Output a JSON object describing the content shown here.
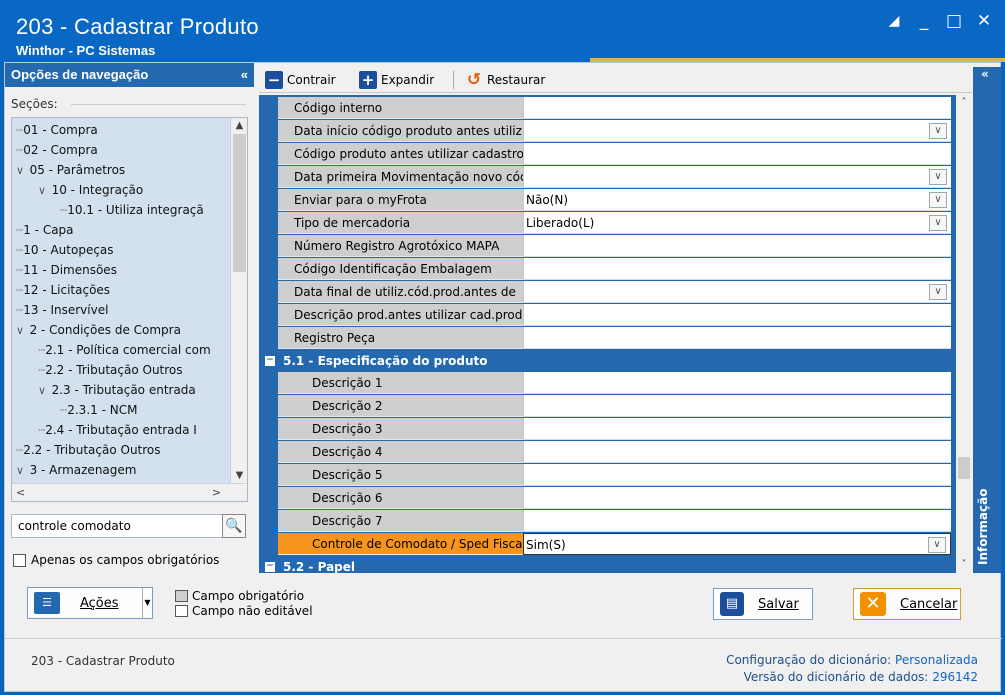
{
  "window": {
    "title": "203 - Cadastrar  Produto",
    "subtitle": "Winthor - PC Sistemas",
    "controls": [
      "■",
      "_",
      "□",
      "✕"
    ]
  },
  "nav": {
    "header": "Opções de navegação",
    "collapse": "«",
    "sections_label": "Seções:",
    "tree": [
      {
        "label": "01 - Compra",
        "level": 0,
        "exp": ""
      },
      {
        "label": "02 - Compra",
        "level": 0,
        "exp": ""
      },
      {
        "label": "05 - Parâmetros",
        "level": 0,
        "exp": "v"
      },
      {
        "label": "10 - Integração",
        "level": 1,
        "exp": "v"
      },
      {
        "label": "10.1 - Utiliza integraçã",
        "level": 2,
        "exp": ""
      },
      {
        "label": "1 - Capa",
        "level": 0,
        "exp": ""
      },
      {
        "label": "10 - Autopeças",
        "level": 0,
        "exp": ""
      },
      {
        "label": "11 - Dimensões",
        "level": 0,
        "exp": ""
      },
      {
        "label": "12 - Licitações",
        "level": 0,
        "exp": ""
      },
      {
        "label": "13 - Inservível",
        "level": 0,
        "exp": ""
      },
      {
        "label": "2 - Condições de Compra",
        "level": 0,
        "exp": "v"
      },
      {
        "label": "2.1 - Política comercial com",
        "level": 1,
        "exp": ""
      },
      {
        "label": "2.2 - Tributação Outros",
        "level": 1,
        "exp": ""
      },
      {
        "label": "2.3 - Tributação entrada",
        "level": 1,
        "exp": "v"
      },
      {
        "label": "2.3.1 - NCM",
        "level": 2,
        "exp": ""
      },
      {
        "label": "2.4 - Tributação entrada I",
        "level": 1,
        "exp": ""
      },
      {
        "label": "2.2 - Tributação Outros",
        "level": 0,
        "exp": ""
      },
      {
        "label": "3 - Armazenagem",
        "level": 0,
        "exp": "v"
      }
    ],
    "search_value": "controle comodato",
    "only_required_label": "Apenas os campos obrigatórios"
  },
  "toolbar": {
    "collapse_label": "Contrair",
    "expand_label": "Expandir",
    "restore_label": "Restaurar"
  },
  "grid": {
    "rows": [
      {
        "label": "Código interno",
        "value": "",
        "dropdown": false
      },
      {
        "label": "Data início código produto antes utiliz",
        "value": "",
        "dropdown": true
      },
      {
        "label": "Código produto antes utilizar cadastro",
        "value": "",
        "dropdown": false
      },
      {
        "label": "Data primeira Movimentação novo cód",
        "value": "",
        "dropdown": true
      },
      {
        "label": "Enviar para o myFrota",
        "value": "Não(N)",
        "dropdown": true
      },
      {
        "label": "Tipo de mercadoria",
        "value": "Liberado(L)",
        "dropdown": true
      },
      {
        "label": "Número Registro Agrotóxico MAPA",
        "value": "",
        "dropdown": false
      },
      {
        "label": "Código Identificação Embalagem",
        "value": "",
        "dropdown": false
      },
      {
        "label": "Data final de utiliz.cód.prod.antes de",
        "value": "",
        "dropdown": true
      },
      {
        "label": "Descrição prod.antes utilizar cad.prod",
        "value": "",
        "dropdown": false
      },
      {
        "label": "Registro Peça",
        "value": "",
        "dropdown": false
      }
    ],
    "group1": "5.1 - Especificação do produto",
    "group1_rows": [
      {
        "label": "Descrição 1",
        "value": ""
      },
      {
        "label": "Descrição 2",
        "value": ""
      },
      {
        "label": "Descrição 3",
        "value": ""
      },
      {
        "label": "Descrição 4",
        "value": ""
      },
      {
        "label": "Descrição 5",
        "value": ""
      },
      {
        "label": "Descrição 6",
        "value": ""
      },
      {
        "label": "Descrição 7",
        "value": ""
      }
    ],
    "highlight_row": {
      "label": "Controle de Comodato / Sped Fiscal",
      "value": "Sim(S)"
    },
    "group2": "5.2 - Papel"
  },
  "info_tab": {
    "label": "Informação",
    "collapse": "«"
  },
  "bottom": {
    "actions_label": "Ações",
    "legend_required": "Campo obrigatório",
    "legend_readonly": "Campo não editável",
    "save_label": "Salvar",
    "cancel_label": "Cancelar"
  },
  "status": {
    "left": "203 - Cadastrar  Produto",
    "dict_config_label": "Configuração do dicionário:",
    "dict_config_value": "Personalizada",
    "dict_version_label": "Versão do dicionário de dados:",
    "dict_version_value": "296142"
  },
  "colors": {
    "titlebar": "#0868c4",
    "nav_header": "#2469b0",
    "highlight": "#f7941d",
    "group": "#2469b0"
  }
}
